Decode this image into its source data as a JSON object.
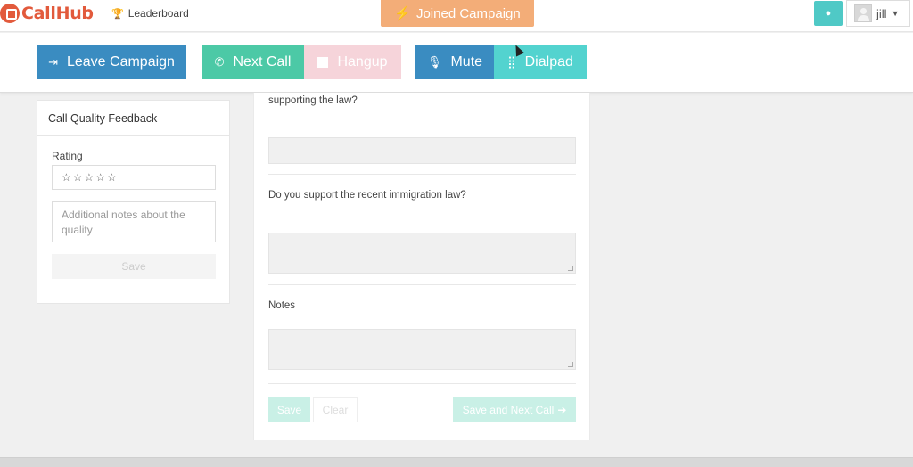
{
  "brand": {
    "name": "CallHub",
    "color": "#e25a3c"
  },
  "nav": {
    "leaderboard": "Leaderboard"
  },
  "status": {
    "joined_label": "Joined Campaign",
    "color": "#f3ad78"
  },
  "user": {
    "name": "jill"
  },
  "actions": {
    "leave": "Leave Campaign",
    "next": "Next Call",
    "hangup": "Hangup",
    "mute": "Mute",
    "dialpad": "Dialpad"
  },
  "feedback": {
    "title": "Call Quality Feedback",
    "rating_label": "Rating",
    "stars": "☆☆☆☆☆",
    "notes_placeholder": "Additional notes about the quality",
    "save": "Save"
  },
  "survey": {
    "q1_tail": "supporting the law?",
    "q2": "Do you support the recent immigration law?",
    "notes_label": "Notes",
    "save": "Save",
    "clear": "Clear",
    "save_next": "Save and Next Call"
  }
}
